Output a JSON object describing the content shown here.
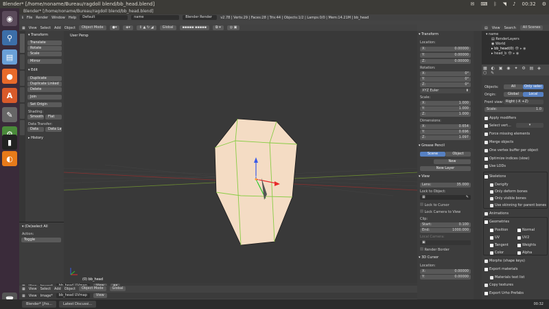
{
  "window_title": "Blender* [/home/noname/Bureau/ragdoll blend/bb_head.blend]",
  "system": {
    "app_title": "Blender* [/home/noname/Bureau/ragdoll blend/bb_head.blend]",
    "time": "00:32"
  },
  "info_bar": {
    "menus": [
      "File",
      "Render",
      "Window",
      "Help"
    ],
    "layout": "Default",
    "scene": "name",
    "engine": "Blender Render",
    "stats": "v2.78 | Verts:29 | Faces:28 | Tris:44 | Objects:1/2 | Lamps:0/0 | Mem:14.21M | bb_head"
  },
  "view3d_header": {
    "menus": [
      "View",
      "Select",
      "Add",
      "Object"
    ],
    "mode": "Object Mode",
    "orientation": "Global"
  },
  "toolshelf": {
    "section_transform": "Transform",
    "transform_buttons": [
      "Translate",
      "Rotate",
      "Scale"
    ],
    "mirror": "Mirror",
    "section_edit": "Edit",
    "edit_buttons": [
      "Duplicate",
      "Duplicate Linked",
      "Delete"
    ],
    "join": "Join",
    "set_origin": "Set Origin",
    "shading_label": "Shading:",
    "smooth": "Smooth",
    "flat": "Flat",
    "data_transfer_label": "Data Transfer:",
    "data": "Data",
    "data_layo": "Data Layo",
    "history": "History"
  },
  "redo_panel": {
    "title": "(De)select All",
    "action_label": "Action:",
    "action_value": "Toggle"
  },
  "viewport": {
    "view_label": "User Persp",
    "object_label": "(0) bb_head"
  },
  "npanel": {
    "transform": "Transform",
    "location_label": "Location:",
    "location": [
      {
        "axis": "X:",
        "value": "0.00000"
      },
      {
        "axis": "Y:",
        "value": "0.00000"
      },
      {
        "axis": "Z:",
        "value": "0.00000"
      }
    ],
    "rotation_label": "Rotation:",
    "rotation": [
      {
        "axis": "X:",
        "value": "0°"
      },
      {
        "axis": "Y:",
        "value": "0°"
      },
      {
        "axis": "Z:",
        "value": "0°"
      }
    ],
    "rotation_mode": "XYZ Euler",
    "scale_label": "Scale:",
    "scale": [
      {
        "axis": "X:",
        "value": "1.000"
      },
      {
        "axis": "Y:",
        "value": "1.000"
      },
      {
        "axis": "Z:",
        "value": "1.000"
      }
    ],
    "dimensions_label": "Dimensions:",
    "dimensions": [
      {
        "axis": "X:",
        "value": "0.654"
      },
      {
        "axis": "Y:",
        "value": "0.696"
      },
      {
        "axis": "Z:",
        "value": "1.097"
      }
    ],
    "grease_pencil": "Grease Pencil",
    "gp_scene": "Scene",
    "gp_object": "Object",
    "gp_new": "New",
    "gp_new_layer": "New Layer",
    "view": "View",
    "lens_label": "Lens:",
    "lens_value": "35.000",
    "lock_to_object": "Lock to Object:",
    "lock_to_cursor": "Lock to Cursor",
    "lock_camera": "Lock Camera to View",
    "clip_label": "Clip:",
    "clip_start_label": "Start:",
    "clip_start": "0.100",
    "clip_end_label": "End:",
    "clip_end": "1000.000",
    "local_camera": "Local Camera:",
    "render_border": "Render Border",
    "cursor_3d": "3D Cursor",
    "cursor_location_label": "Location:",
    "cursor_location": [
      {
        "axis": "X:",
        "value": "0.00000"
      },
      {
        "axis": "Y:",
        "value": "0.00000"
      }
    ]
  },
  "outliner": {
    "header": [
      "View",
      "Search",
      "All Scenes"
    ],
    "items": [
      "name",
      "RenderLayers",
      "World",
      "bb_head(0)",
      "head_b"
    ]
  },
  "properties": {
    "objects_label": "Objects:",
    "all": "All",
    "only_selected": "Only selec",
    "origin_label": "Origin:",
    "origin_global": "Global",
    "origin_local": "Local",
    "front_view_label": "Front view:",
    "front_view_value": "Right (-X +Z)",
    "scale_label": "Scale:",
    "scale_value": "1.0",
    "options": [
      "Apply modifiers",
      "Select vert..."
    ],
    "options2": [
      "Force missing elements",
      "Merge objects",
      "One vertex buffer per object",
      "Optimize indices (slow)",
      "Use LODs"
    ],
    "skeletons": "Skeletons",
    "skeleton_opts": [
      "Derigify",
      "Only deform bones",
      "Only visible bones",
      "Use skinning for parent bones"
    ],
    "animations": "Animations",
    "geometries": "Geometries",
    "geom_grid": [
      [
        "Position",
        "Normal"
      ],
      [
        "UV",
        "UV2"
      ],
      [
        "Tangent",
        "Weights"
      ],
      [
        "Color",
        "Alpha"
      ]
    ],
    "morphs": "Morphs (shape keys)",
    "export_materials": "Export materials",
    "materials_text_list": "Materials text list",
    "copy_textures": "Copy textures",
    "export_urho_prefabs": "Export Urho Prefabs"
  },
  "uv_header": {
    "menus": [
      "View",
      "Image*"
    ],
    "image": "bb_head UVmap",
    "view": "View"
  },
  "taskbar": {
    "items": [
      "Blender* [/ho...",
      "Latest Discussi..."
    ],
    "clock": "00:32"
  },
  "colors": {
    "accent": "#5680c2",
    "mesh": "#f4dcc4",
    "wire": "#1a1a1a",
    "select": "#88cc44"
  }
}
